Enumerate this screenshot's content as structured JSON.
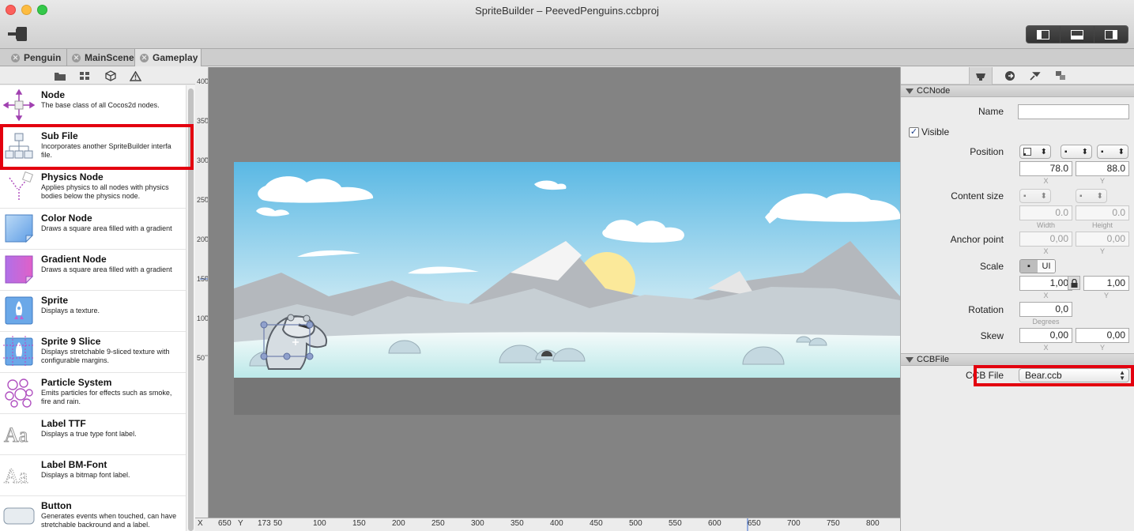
{
  "window": {
    "title": "SpriteBuilder – PeevedPenguins.ccbproj"
  },
  "toolbar": {
    "exit_icon": "exit-door-icon",
    "layout_icons": [
      "left-panel-icon",
      "bottom-panel-icon",
      "right-panel-icon"
    ]
  },
  "tabs": [
    {
      "label": "Penguin",
      "active": false
    },
    {
      "label": "MainScene",
      "active": false
    },
    {
      "label": "Gameplay",
      "active": true
    }
  ],
  "library": {
    "toolbar_icons": [
      "folder-icon",
      "grid-icon",
      "cube-icon",
      "warning-icon"
    ],
    "items": [
      {
        "name": "Node",
        "desc": "The base class of all Cocos2d nodes."
      },
      {
        "name": "Sub File",
        "desc": "Incorporates another SpriteBuilder interfa\nfile."
      },
      {
        "name": "Physics Node",
        "desc": "Applies physics to all nodes with physics\nbodies below the physics node."
      },
      {
        "name": "Color Node",
        "desc": "Draws a square area filled with a gradient"
      },
      {
        "name": "Gradient Node",
        "desc": "Draws a square area filled with a gradient"
      },
      {
        "name": "Sprite",
        "desc": "Displays a texture."
      },
      {
        "name": "Sprite 9 Slice",
        "desc": "Displays stretchable 9-sliced texture with\nconfigurable margins."
      },
      {
        "name": "Particle System",
        "desc": "Emits particles for effects such as smoke,\nfire and rain."
      },
      {
        "name": "Label TTF",
        "desc": "Displays a true type font label."
      },
      {
        "name": "Label BM-Font",
        "desc": "Displays a bitmap font label."
      },
      {
        "name": "Button",
        "desc": "Generates events when touched, can have\nstretchable backround and a label."
      }
    ]
  },
  "ruler": {
    "vertical": [
      "400",
      "350",
      "300",
      "250",
      "200",
      "150",
      "100",
      "50"
    ],
    "x_label": "X",
    "x_value": "650",
    "y_label": "Y",
    "y_value": "173",
    "horizontal": [
      "50",
      "100",
      "150",
      "200",
      "250",
      "300",
      "350",
      "400",
      "450",
      "500",
      "550",
      "600",
      "650",
      "700",
      "750",
      "800"
    ]
  },
  "inspector": {
    "toolbar_icons": [
      "node-properties-icon",
      "code-connections-icon",
      "physics-icon",
      "templates-icon"
    ],
    "ccnode_header": "CCNode",
    "name_label": "Name",
    "name_value": "",
    "visible_label": "Visible",
    "visible_checked": "✓",
    "position_label": "Position",
    "position_x": "78.0",
    "position_y": "88.0",
    "x_caption": "X",
    "y_caption": "Y",
    "content_size_label": "Content size",
    "content_w": "0.0",
    "content_h": "0.0",
    "width_caption": "Width",
    "height_caption": "Height",
    "anchor_label": "Anchor point",
    "anchor_x": "0,00",
    "anchor_y": "0,00",
    "scale_label": "Scale",
    "scale_ui": "UI",
    "scale_x": "1,00",
    "scale_y": "1,00",
    "rotation_label": "Rotation",
    "rotation_value": "0,0",
    "degrees_caption": "Degrees",
    "skew_label": "Skew",
    "skew_x": "0,00",
    "skew_y": "0,00",
    "ccbfile_header": "CCBFile",
    "ccb_file_label": "CCB File",
    "ccb_file_value": "Bear.ccb"
  },
  "colors": {
    "highlight": "#e3000f",
    "sky_top": "#5ab8e4",
    "sky_bottom": "#cdeaf5",
    "snow": "#e9f6f6"
  }
}
